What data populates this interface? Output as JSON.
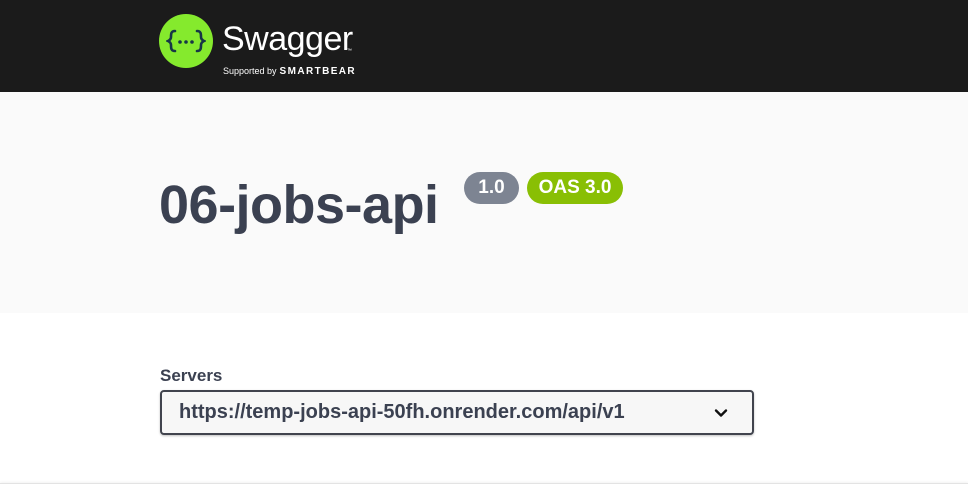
{
  "header": {
    "logo_word": "Swagger",
    "logo_tm": "™",
    "supported_by": "Supported by",
    "brand": "SMARTBEAR",
    "logo_icon": "swagger-braces-icon",
    "colors": {
      "background": "#1b1b1b",
      "logo_green": "#85ea2d"
    }
  },
  "info": {
    "title": "06-jobs-api",
    "version_badge": "1.0",
    "oas_badge": "OAS 3.0",
    "colors": {
      "version_badge": "#7d8492",
      "oas_badge": "#89bf04",
      "title": "#3b4151"
    }
  },
  "servers": {
    "label": "Servers",
    "selected": "https://temp-jobs-api-50fh.onrender.com/api/v1",
    "dropdown_icon": "chevron-down-icon"
  }
}
